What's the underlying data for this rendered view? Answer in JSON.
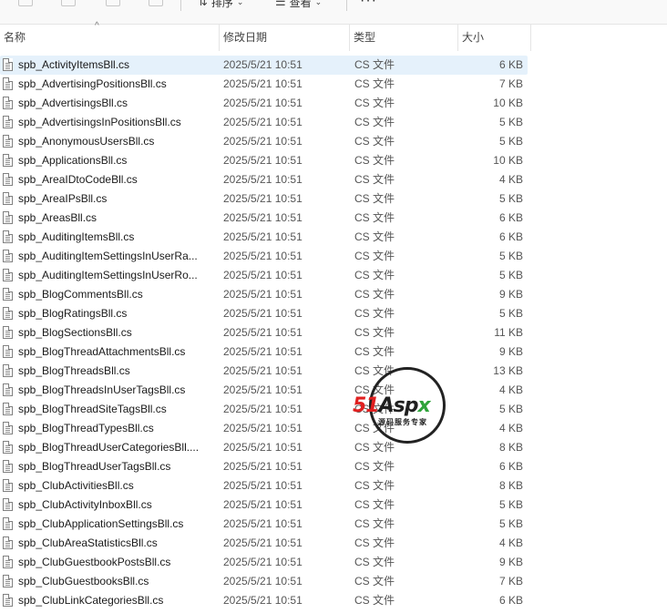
{
  "toolbar": {
    "sort_label": "排序",
    "view_label": "查看",
    "more_label": "···"
  },
  "columns": {
    "name": "名称",
    "date": "修改日期",
    "type": "类型",
    "size": "大小"
  },
  "files": [
    {
      "name": "spb_ActivityItemsBll.cs",
      "date": "2025/5/21 10:51",
      "type": "CS 文件",
      "size": "6 KB",
      "selected": true
    },
    {
      "name": "spb_AdvertisingPositionsBll.cs",
      "date": "2025/5/21 10:51",
      "type": "CS 文件",
      "size": "7 KB"
    },
    {
      "name": "spb_AdvertisingsBll.cs",
      "date": "2025/5/21 10:51",
      "type": "CS 文件",
      "size": "10 KB"
    },
    {
      "name": "spb_AdvertisingsInPositionsBll.cs",
      "date": "2025/5/21 10:51",
      "type": "CS 文件",
      "size": "5 KB"
    },
    {
      "name": "spb_AnonymousUsersBll.cs",
      "date": "2025/5/21 10:51",
      "type": "CS 文件",
      "size": "5 KB"
    },
    {
      "name": "spb_ApplicationsBll.cs",
      "date": "2025/5/21 10:51",
      "type": "CS 文件",
      "size": "10 KB"
    },
    {
      "name": "spb_AreaIDtoCodeBll.cs",
      "date": "2025/5/21 10:51",
      "type": "CS 文件",
      "size": "4 KB"
    },
    {
      "name": "spb_AreaIPsBll.cs",
      "date": "2025/5/21 10:51",
      "type": "CS 文件",
      "size": "5 KB"
    },
    {
      "name": "spb_AreasBll.cs",
      "date": "2025/5/21 10:51",
      "type": "CS 文件",
      "size": "6 KB"
    },
    {
      "name": "spb_AuditingItemsBll.cs",
      "date": "2025/5/21 10:51",
      "type": "CS 文件",
      "size": "6 KB"
    },
    {
      "name": "spb_AuditingItemSettingsInUserRa...",
      "date": "2025/5/21 10:51",
      "type": "CS 文件",
      "size": "5 KB"
    },
    {
      "name": "spb_AuditingItemSettingsInUserRo...",
      "date": "2025/5/21 10:51",
      "type": "CS 文件",
      "size": "5 KB"
    },
    {
      "name": "spb_BlogCommentsBll.cs",
      "date": "2025/5/21 10:51",
      "type": "CS 文件",
      "size": "9 KB"
    },
    {
      "name": "spb_BlogRatingsBll.cs",
      "date": "2025/5/21 10:51",
      "type": "CS 文件",
      "size": "5 KB"
    },
    {
      "name": "spb_BlogSectionsBll.cs",
      "date": "2025/5/21 10:51",
      "type": "CS 文件",
      "size": "11 KB"
    },
    {
      "name": "spb_BlogThreadAttachmentsBll.cs",
      "date": "2025/5/21 10:51",
      "type": "CS 文件",
      "size": "9 KB"
    },
    {
      "name": "spb_BlogThreadsBll.cs",
      "date": "2025/5/21 10:51",
      "type": "CS 文件",
      "size": "13 KB"
    },
    {
      "name": "spb_BlogThreadsInUserTagsBll.cs",
      "date": "2025/5/21 10:51",
      "type": "CS 文件",
      "size": "4 KB"
    },
    {
      "name": "spb_BlogThreadSiteTagsBll.cs",
      "date": "2025/5/21 10:51",
      "type": "CS 文件",
      "size": "5 KB"
    },
    {
      "name": "spb_BlogThreadTypesBll.cs",
      "date": "2025/5/21 10:51",
      "type": "CS 文件",
      "size": "4 KB"
    },
    {
      "name": "spb_BlogThreadUserCategoriesBll....",
      "date": "2025/5/21 10:51",
      "type": "CS 文件",
      "size": "8 KB"
    },
    {
      "name": "spb_BlogThreadUserTagsBll.cs",
      "date": "2025/5/21 10:51",
      "type": "CS 文件",
      "size": "6 KB"
    },
    {
      "name": "spb_ClubActivitiesBll.cs",
      "date": "2025/5/21 10:51",
      "type": "CS 文件",
      "size": "8 KB"
    },
    {
      "name": "spb_ClubActivityInboxBll.cs",
      "date": "2025/5/21 10:51",
      "type": "CS 文件",
      "size": "5 KB"
    },
    {
      "name": "spb_ClubApplicationSettingsBll.cs",
      "date": "2025/5/21 10:51",
      "type": "CS 文件",
      "size": "5 KB"
    },
    {
      "name": "spb_ClubAreaStatisticsBll.cs",
      "date": "2025/5/21 10:51",
      "type": "CS 文件",
      "size": "4 KB"
    },
    {
      "name": "spb_ClubGuestbookPostsBll.cs",
      "date": "2025/5/21 10:51",
      "type": "CS 文件",
      "size": "9 KB"
    },
    {
      "name": "spb_ClubGuestbooksBll.cs",
      "date": "2025/5/21 10:51",
      "type": "CS 文件",
      "size": "7 KB"
    },
    {
      "name": "spb_ClubLinkCategoriesBll.cs",
      "date": "2025/5/21 10:51",
      "type": "CS 文件",
      "size": "6 KB"
    }
  ],
  "watermark": {
    "logo_51": "51",
    "logo_asp": "Asp",
    "logo_x": "x",
    "tagline": "源码服务专家"
  },
  "colors": {
    "selected_row": "#e5f1fb",
    "watermark_red": "#e02020",
    "watermark_green": "#2fa33a"
  }
}
